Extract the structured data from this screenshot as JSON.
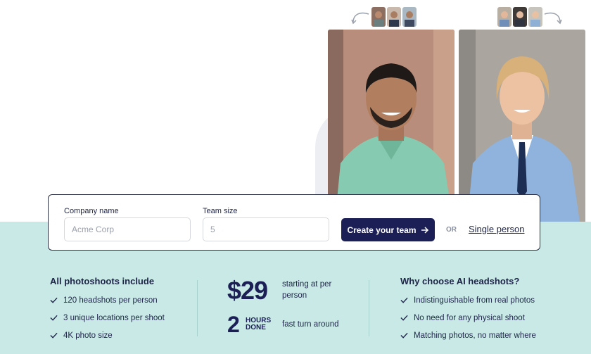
{
  "colors": {
    "teal_band": "#c8e9e6",
    "navy": "#1b1f55",
    "text": "#1e2448",
    "muted": "#8a90a0"
  },
  "form": {
    "company_label": "Company name",
    "company_placeholder": "Acme Corp",
    "team_label": "Team size",
    "team_placeholder": "5",
    "cta_label": "Create your team",
    "cta_icon": "arrow-right-icon",
    "or_label": "OR",
    "single_link": "Single person"
  },
  "includes": {
    "title": "All photoshoots include",
    "items": [
      "120 headshots per person",
      "3 unique locations per shoot",
      "4K photo size"
    ]
  },
  "pricing": {
    "price": "$29",
    "price_note": "starting at per person",
    "hours_value": "2",
    "hours_unit_line1": "HOURS",
    "hours_unit_line2": "DONE",
    "hours_note": "fast turn around"
  },
  "why": {
    "title": "Why choose AI headshots?",
    "items": [
      "Indistinguishable from real photos",
      "No need for any physical shoot",
      "Matching photos, no matter where"
    ]
  }
}
